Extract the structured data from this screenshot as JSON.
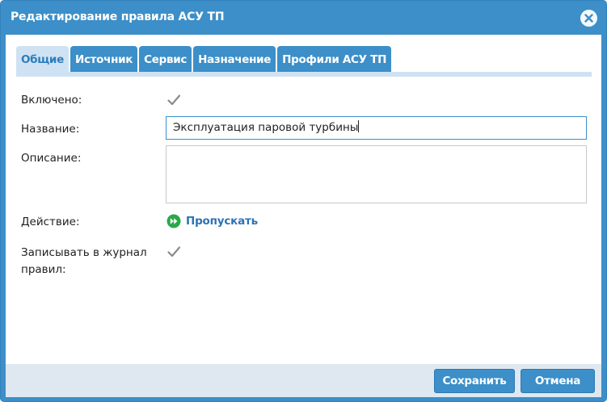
{
  "dialog": {
    "title": "Редактирование правила АСУ ТП",
    "close_icon": "close-icon"
  },
  "tabs": [
    {
      "label": "Общие",
      "active": true
    },
    {
      "label": "Источник",
      "active": false
    },
    {
      "label": "Сервис",
      "active": false
    },
    {
      "label": "Назначение",
      "active": false
    },
    {
      "label": "Профили АСУ ТП",
      "active": false
    }
  ],
  "form": {
    "enabled_label": "Включено:",
    "enabled_checked": true,
    "name_label": "Название:",
    "name_value": "Эксплуатация паровой турбины",
    "description_label": "Описание:",
    "description_value": "",
    "action_label": "Действие:",
    "action_value": "Пропускать",
    "action_icon": "fast-forward-icon",
    "log_label_line1": "Записывать в журнал",
    "log_label_line2": "правил:",
    "log_checked": true
  },
  "footer": {
    "save_label": "Сохранить",
    "cancel_label": "Отмена"
  },
  "colors": {
    "accent": "#3c8fc8",
    "tab_active_bg": "#cfe2f3",
    "link": "#2c72b5",
    "action_icon_green": "#2aa84a"
  }
}
